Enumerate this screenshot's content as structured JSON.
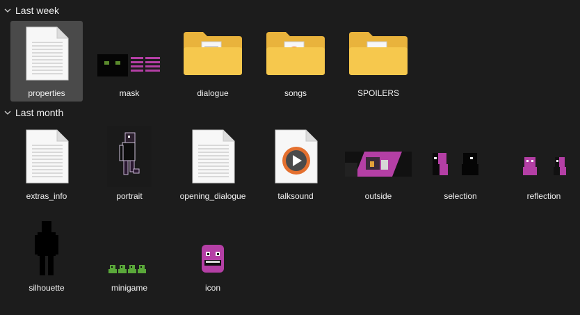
{
  "groups": [
    {
      "label": "Last week"
    },
    {
      "label": "Last month"
    }
  ],
  "items": [
    {
      "name": "properties",
      "type": "text-file",
      "selected": true
    },
    {
      "name": "mask",
      "type": "image"
    },
    {
      "name": "dialogue",
      "type": "folder"
    },
    {
      "name": "songs",
      "type": "folder"
    },
    {
      "name": "SPOILERS",
      "type": "folder"
    },
    {
      "name": "extras_info",
      "type": "text-file"
    },
    {
      "name": "portrait",
      "type": "image"
    },
    {
      "name": "opening_dialogue",
      "type": "text-file"
    },
    {
      "name": "talksound",
      "type": "audio-file"
    },
    {
      "name": "outside",
      "type": "image"
    },
    {
      "name": "selection",
      "type": "image"
    },
    {
      "name": "reflection",
      "type": "image"
    },
    {
      "name": "silhouette",
      "type": "image"
    },
    {
      "name": "minigame",
      "type": "image"
    },
    {
      "name": "icon",
      "type": "image"
    }
  ],
  "colors": {
    "background": "#1c1c1c",
    "selected": "#4a4a4a",
    "folder": "#f6c84d",
    "purple": "#b43fa5",
    "text": "#f0f0f0"
  }
}
